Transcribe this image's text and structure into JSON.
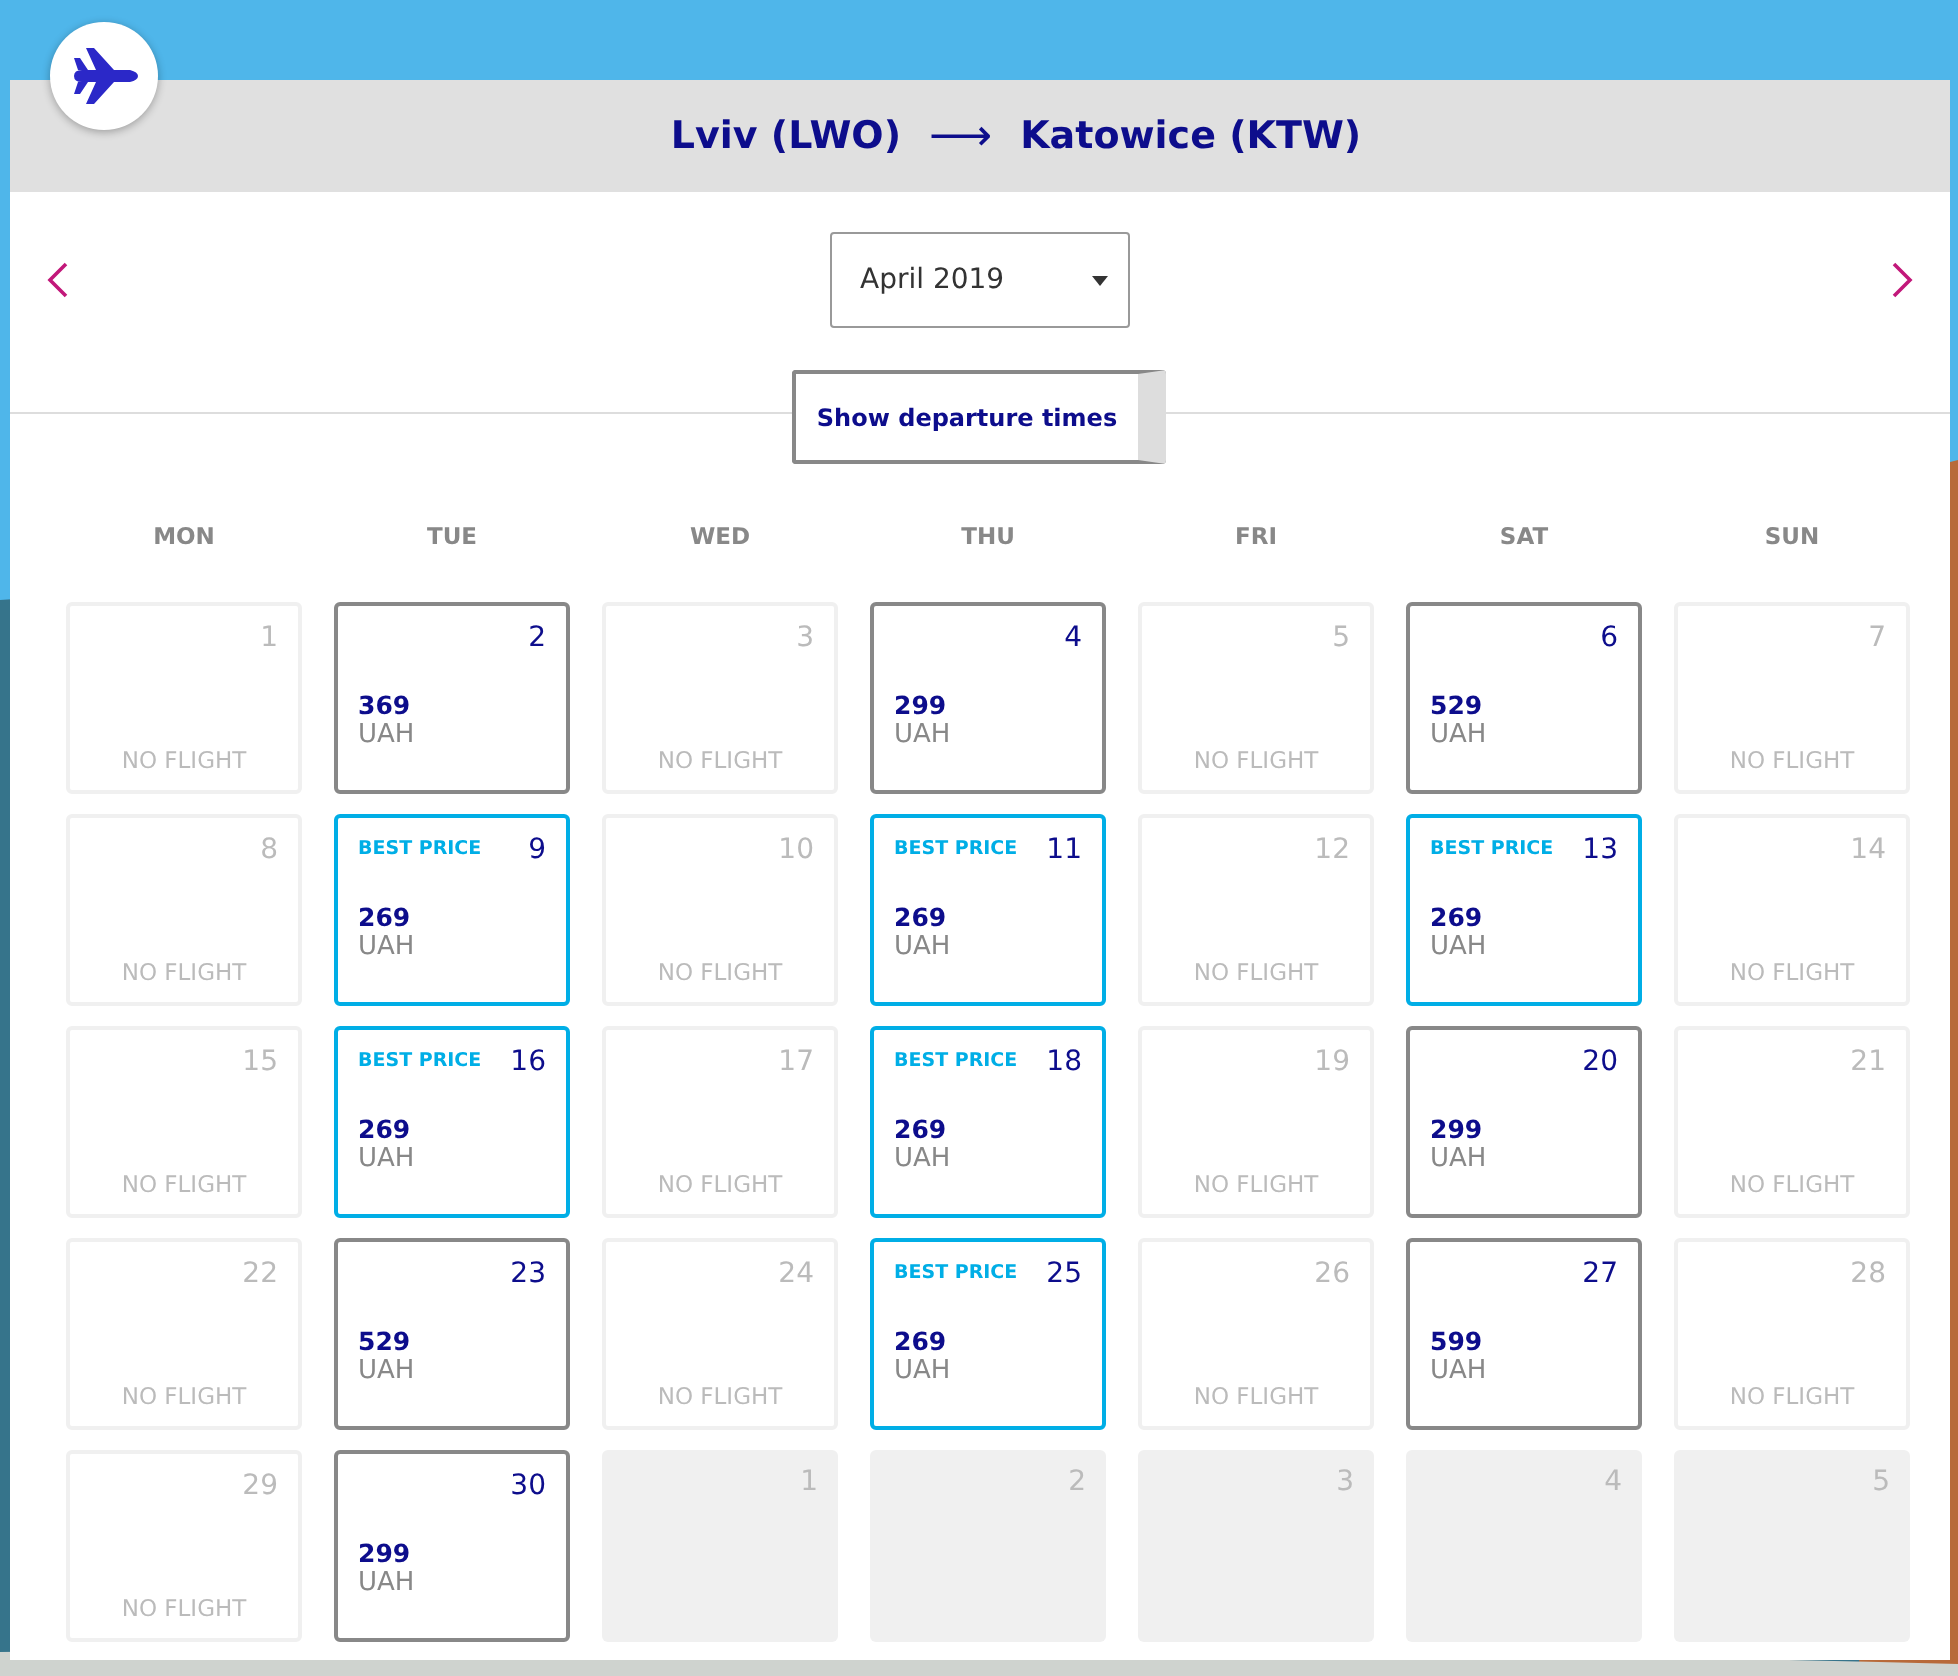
{
  "route": {
    "origin": "Lviv (LWO)",
    "arrow": "⟶",
    "destination": "Katowice (KTW)"
  },
  "month_select": {
    "value": "April 2019"
  },
  "toggle_button": {
    "label": "Show departure times"
  },
  "weekdays": [
    "MON",
    "TUE",
    "WED",
    "THU",
    "FRI",
    "SAT",
    "SUN"
  ],
  "days": [
    {
      "kind": "no_flight",
      "day": "1",
      "note": "NO FLIGHT"
    },
    {
      "kind": "flight",
      "day": "2",
      "price": "369",
      "currency": "UAH",
      "best": false
    },
    {
      "kind": "no_flight",
      "day": "3",
      "note": "NO FLIGHT"
    },
    {
      "kind": "flight",
      "day": "4",
      "price": "299",
      "currency": "UAH",
      "best": false
    },
    {
      "kind": "no_flight",
      "day": "5",
      "note": "NO FLIGHT"
    },
    {
      "kind": "flight",
      "day": "6",
      "price": "529",
      "currency": "UAH",
      "best": false
    },
    {
      "kind": "no_flight",
      "day": "7",
      "note": "NO FLIGHT"
    },
    {
      "kind": "no_flight",
      "day": "8",
      "note": "NO FLIGHT"
    },
    {
      "kind": "flight",
      "day": "9",
      "price": "269",
      "currency": "UAH",
      "best": true,
      "badge": "BEST PRICE"
    },
    {
      "kind": "no_flight",
      "day": "10",
      "note": "NO FLIGHT"
    },
    {
      "kind": "flight",
      "day": "11",
      "price": "269",
      "currency": "UAH",
      "best": true,
      "badge": "BEST PRICE"
    },
    {
      "kind": "no_flight",
      "day": "12",
      "note": "NO FLIGHT"
    },
    {
      "kind": "flight",
      "day": "13",
      "price": "269",
      "currency": "UAH",
      "best": true,
      "badge": "BEST PRICE"
    },
    {
      "kind": "no_flight",
      "day": "14",
      "note": "NO FLIGHT"
    },
    {
      "kind": "no_flight",
      "day": "15",
      "note": "NO FLIGHT"
    },
    {
      "kind": "flight",
      "day": "16",
      "price": "269",
      "currency": "UAH",
      "best": true,
      "badge": "BEST PRICE"
    },
    {
      "kind": "no_flight",
      "day": "17",
      "note": "NO FLIGHT"
    },
    {
      "kind": "flight",
      "day": "18",
      "price": "269",
      "currency": "UAH",
      "best": true,
      "badge": "BEST PRICE"
    },
    {
      "kind": "no_flight",
      "day": "19",
      "note": "NO FLIGHT"
    },
    {
      "kind": "flight",
      "day": "20",
      "price": "299",
      "currency": "UAH",
      "best": false
    },
    {
      "kind": "no_flight",
      "day": "21",
      "note": "NO FLIGHT"
    },
    {
      "kind": "no_flight",
      "day": "22",
      "note": "NO FLIGHT"
    },
    {
      "kind": "flight",
      "day": "23",
      "price": "529",
      "currency": "UAH",
      "best": false
    },
    {
      "kind": "no_flight",
      "day": "24",
      "note": "NO FLIGHT"
    },
    {
      "kind": "flight",
      "day": "25",
      "price": "269",
      "currency": "UAH",
      "best": true,
      "badge": "BEST PRICE"
    },
    {
      "kind": "no_flight",
      "day": "26",
      "note": "NO FLIGHT"
    },
    {
      "kind": "flight",
      "day": "27",
      "price": "599",
      "currency": "UAH",
      "best": false
    },
    {
      "kind": "no_flight",
      "day": "28",
      "note": "NO FLIGHT"
    },
    {
      "kind": "no_flight",
      "day": "29",
      "note": "NO FLIGHT"
    },
    {
      "kind": "flight",
      "day": "30",
      "price": "299",
      "currency": "UAH",
      "best": false
    },
    {
      "kind": "other_month",
      "day": "1"
    },
    {
      "kind": "other_month",
      "day": "2"
    },
    {
      "kind": "other_month",
      "day": "3"
    },
    {
      "kind": "other_month",
      "day": "4"
    },
    {
      "kind": "other_month",
      "day": "5"
    }
  ]
}
